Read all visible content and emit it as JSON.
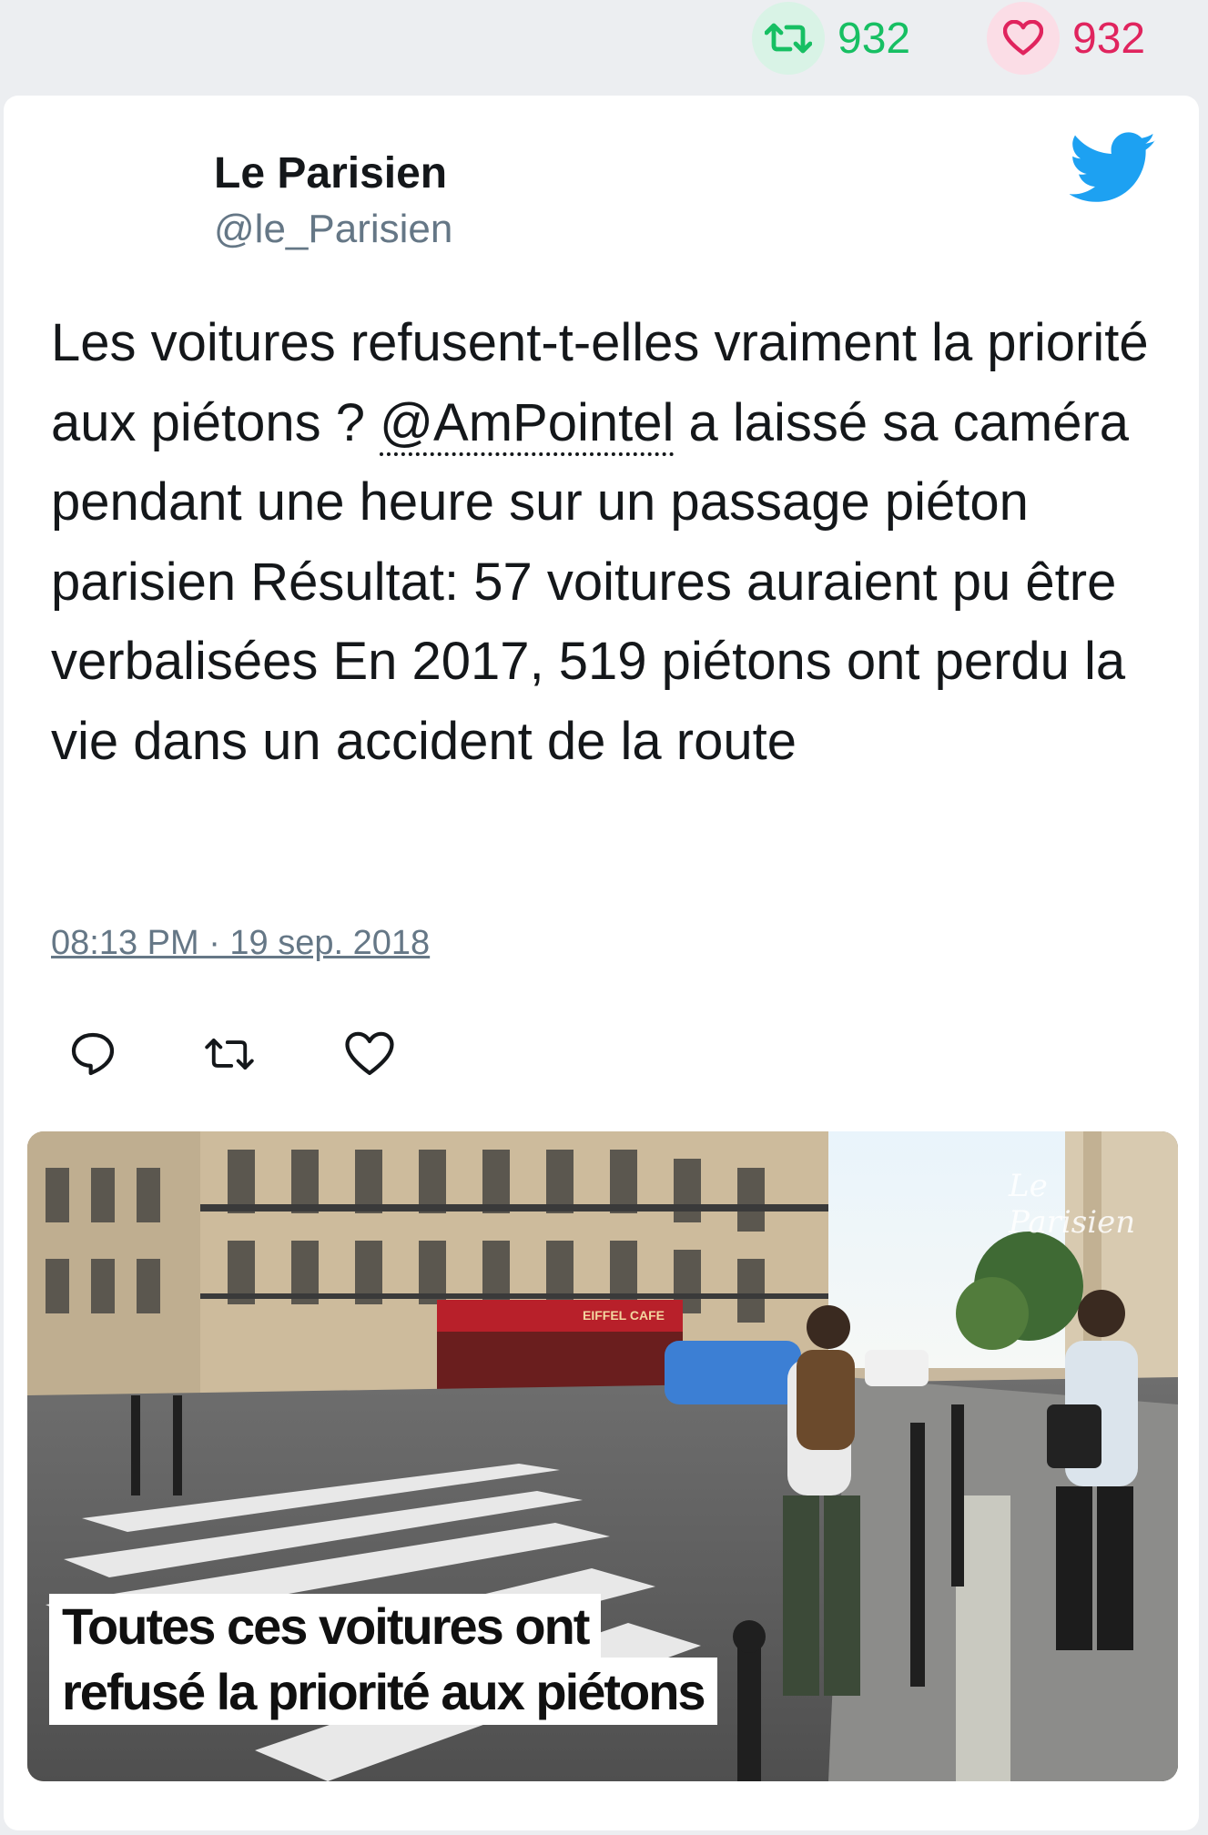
{
  "top_stats": {
    "retweets": "932",
    "likes": "932"
  },
  "author": {
    "name": "Le Parisien",
    "handle": "@le_Parisien"
  },
  "tweet": {
    "text_before": "Les voitures refusent-t-elles vraiment la priorité aux piétons ? ",
    "mention": "@AmPointel",
    "text_after": " a laissé sa caméra pendant une heure sur un passage piéton parisien Résultat: 57 voitures auraient pu être verbalisées En 2017, 519 piétons ont perdu la vie dans un accident de la route",
    "timestamp": "08:13 PM · 19 sep. 2018"
  },
  "media": {
    "watermark": "Le Parisien",
    "caption_line1": "Toutes ces voitures ont",
    "caption_line2": "refusé la priorité aux piétons",
    "awning_text": "EIFFEL CAFE"
  },
  "colors": {
    "retweet_green": "#17bf63",
    "like_red": "#e0245e",
    "twitter_blue": "#1da1f2",
    "secondary_text": "#657786"
  }
}
